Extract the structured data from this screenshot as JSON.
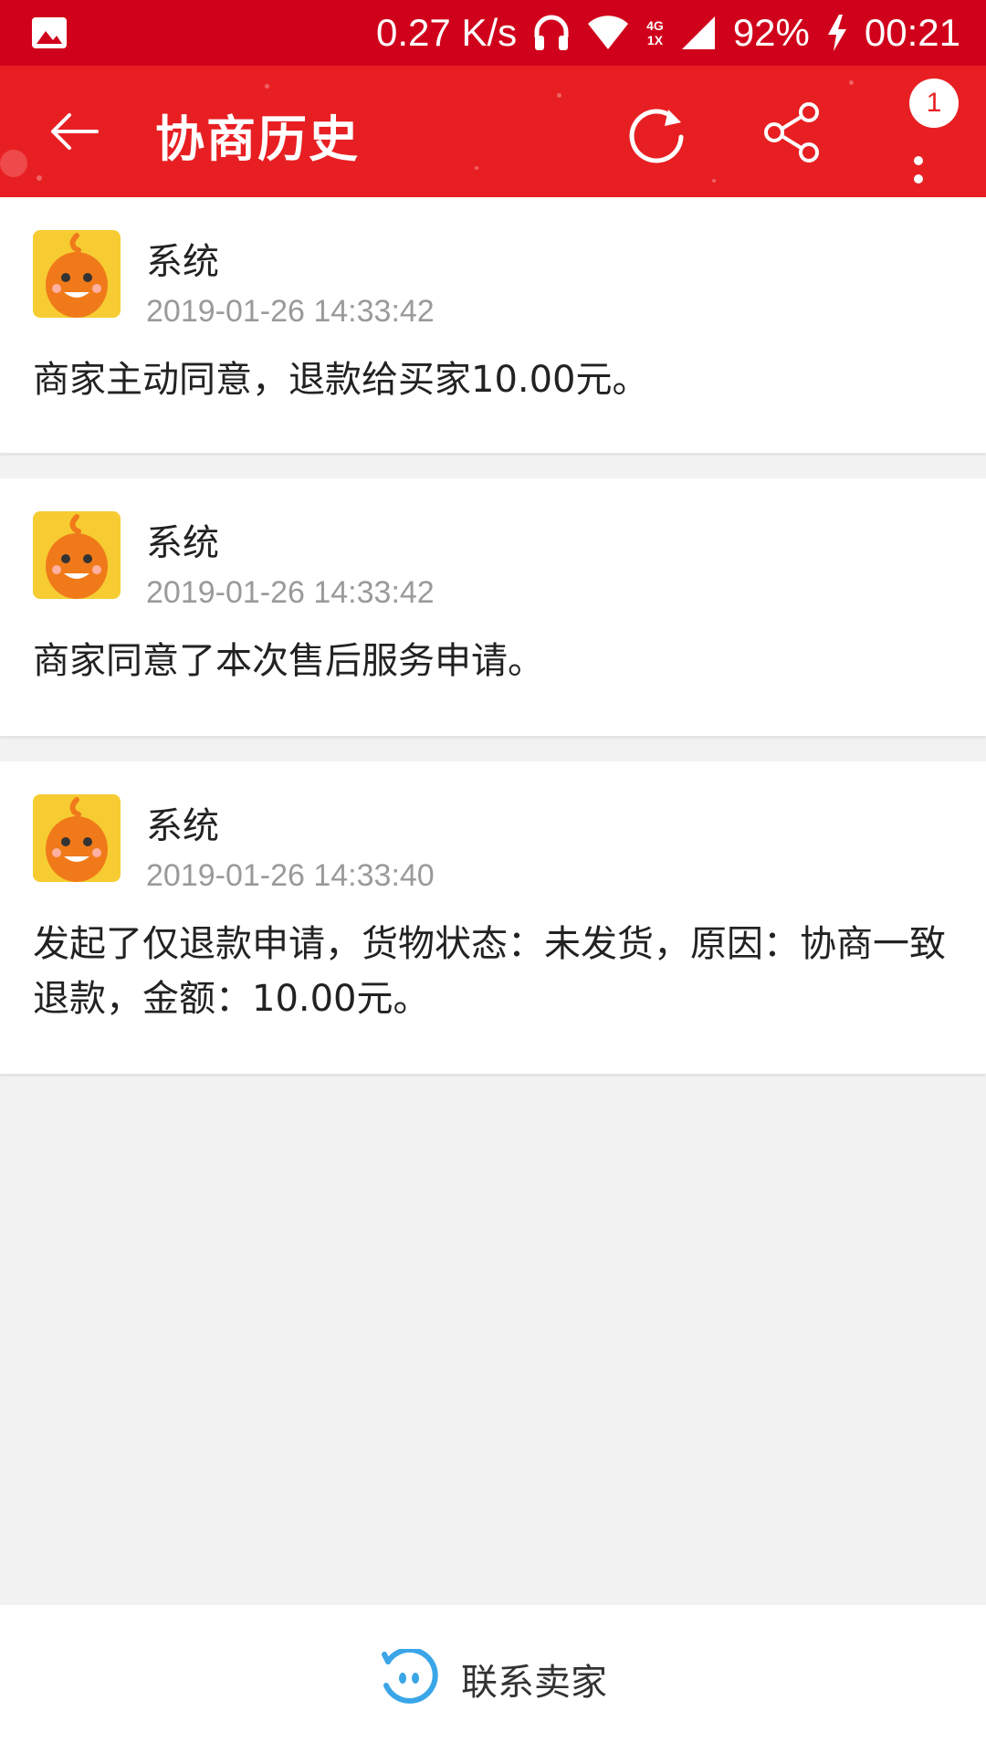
{
  "status_bar": {
    "network_speed": "0.27 K/s",
    "network_type_top": "4G",
    "network_type_bottom": "1X",
    "battery": "92%",
    "time": "00:21"
  },
  "app_bar": {
    "title": "协商历史",
    "menu_badge": "1"
  },
  "history": [
    {
      "sender": "系统",
      "time": "2019-01-26 14:33:42",
      "content": "商家主动同意，退款给买家10.00元。"
    },
    {
      "sender": "系统",
      "time": "2019-01-26 14:33:42",
      "content": "商家同意了本次售后服务申请。"
    },
    {
      "sender": "系统",
      "time": "2019-01-26 14:33:40",
      "content": "发起了仅退款申请，货物状态：未发货，原因：协商一致退款，金额：10.00元。"
    }
  ],
  "bottom_bar": {
    "contact_label": "联系卖家"
  },
  "colors": {
    "status_bar": "#d0021b",
    "app_bar": "#e81f22",
    "avatar_bg": "#f6cc32",
    "contact_icon": "#3aa6e8"
  },
  "icons": {
    "gallery": "image-icon",
    "headphones": "headphones-icon",
    "wifi": "wifi-icon",
    "signal": "signal-icon",
    "charging": "charging-icon",
    "back": "arrow-left-icon",
    "refresh": "refresh-icon",
    "share": "share-icon",
    "more": "more-vertical-icon",
    "contact": "chat-face-icon"
  }
}
